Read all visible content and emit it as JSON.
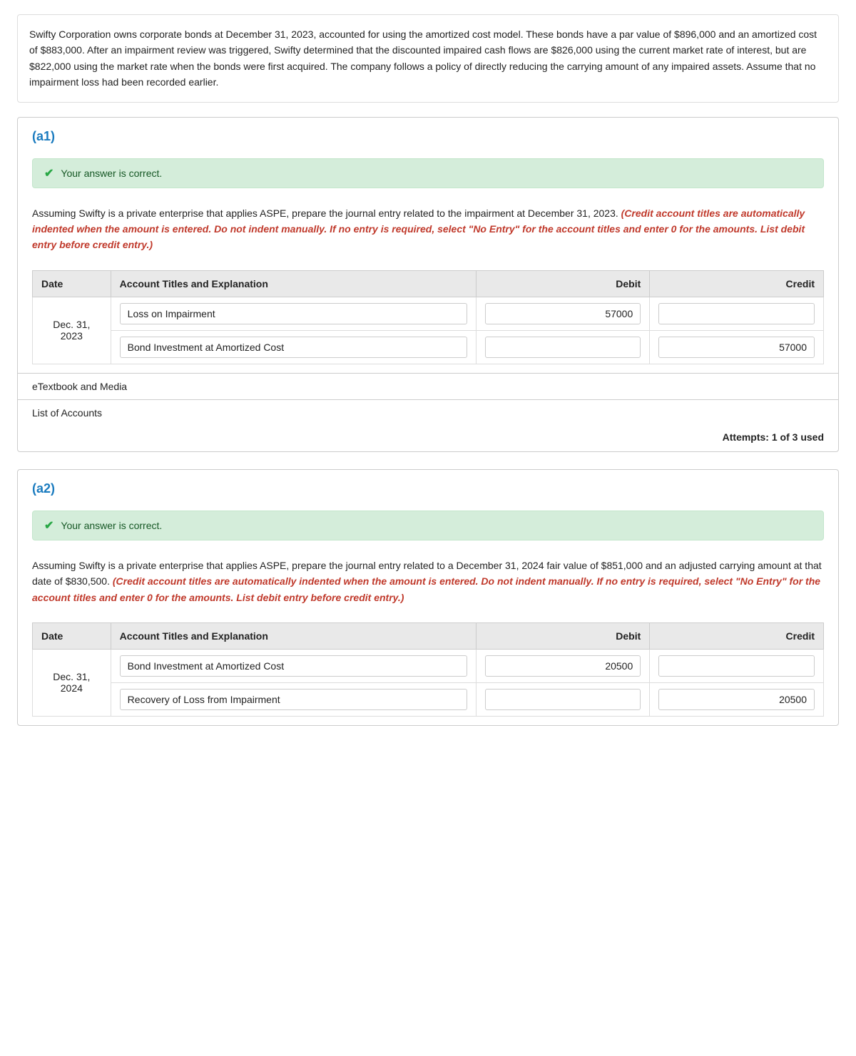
{
  "intro": {
    "text": "Swifty Corporation owns corporate bonds at December 31, 2023, accounted for using the amortized cost model. These bonds have a par value of $896,000 and an amortized cost of $883,000. After an impairment review was triggered, Swifty determined that the discounted impaired cash flows are $826,000 using the current market rate of interest, but are $822,000 using the market rate when the bonds were first acquired. The company follows a policy of directly reducing the carrying amount of any impaired assets. Assume that no impairment loss had been recorded earlier."
  },
  "section_a1": {
    "label": "(a1)",
    "correct_message": "Your answer is correct.",
    "question": "Assuming Swifty is a private enterprise that applies ASPE, prepare the journal entry related to the impairment at December 31, 2023.",
    "instruction": "(Credit account titles are automatically indented when the amount is entered. Do not indent manually. If no entry is required, select \"No Entry\" for the account titles and enter 0 for the amounts. List debit entry before credit entry.)",
    "table": {
      "headers": [
        "Date",
        "Account Titles and Explanation",
        "Debit",
        "Credit"
      ],
      "rows": [
        {
          "date": "Dec. 31, 2023",
          "entries": [
            {
              "account": "Loss on Impairment",
              "debit": "57000",
              "credit": ""
            },
            {
              "account": "Bond Investment at Amortized Cost",
              "debit": "",
              "credit": "57000"
            }
          ]
        }
      ]
    },
    "footer_links": [
      "eTextbook and Media",
      "List of Accounts"
    ],
    "attempts": "Attempts: 1 of 3 used"
  },
  "section_a2": {
    "label": "(a2)",
    "correct_message": "Your answer is correct.",
    "question": "Assuming Swifty is a private enterprise that applies ASPE, prepare the journal entry related to a December 31, 2024 fair value of $851,000 and an adjusted carrying amount at that date of $830,500.",
    "instruction": "(Credit account titles are automatically indented when the amount is entered. Do not indent manually. If no entry is required, select \"No Entry\" for the account titles and enter 0 for the amounts. List debit entry before credit entry.)",
    "table": {
      "headers": [
        "Date",
        "Account Titles and Explanation",
        "Debit",
        "Credit"
      ],
      "rows": [
        {
          "date": "Dec. 31, 2024",
          "entries": [
            {
              "account": "Bond Investment at Amortized Cost",
              "debit": "20500",
              "credit": ""
            },
            {
              "account": "Recovery of Loss from Impairment",
              "debit": "",
              "credit": "20500"
            }
          ]
        }
      ]
    },
    "footer_links": [],
    "attempts": ""
  }
}
